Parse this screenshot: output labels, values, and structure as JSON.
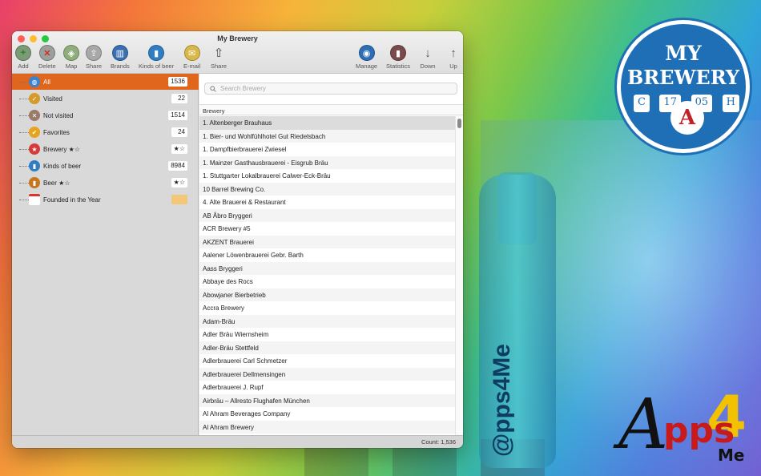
{
  "window": {
    "title": "My Brewery"
  },
  "toolbar": {
    "add": "Add",
    "delete": "Delete",
    "map": "Map",
    "share1": "Share",
    "brands": "Brands",
    "kinds": "Kinds of beer",
    "email": "E-mail",
    "share2": "Share",
    "manage": "Manage",
    "statistics": "Statistics",
    "down": "Down",
    "up": "Up"
  },
  "sidebar": {
    "items": [
      {
        "label": "All",
        "count": "1536"
      },
      {
        "label": "Visited",
        "count": "22"
      },
      {
        "label": "Not visited",
        "count": "1514"
      },
      {
        "label": "Favorites",
        "count": "24"
      },
      {
        "label": "Brewery ★☆",
        "count": "★☆"
      },
      {
        "label": "Kinds of beer",
        "count": "8984"
      },
      {
        "label": "Beer ★☆",
        "count": "★☆"
      },
      {
        "label": "Founded in the Year",
        "count": ""
      }
    ]
  },
  "search": {
    "placeholder": "Search Brewery"
  },
  "table": {
    "column": "Brewery",
    "rows": [
      "1. Altenberger Brauhaus",
      "1. Bier- und Wohlfühlhotel Gut Riedelsbach",
      "1. Dampfbierbrauerei Zwiesel",
      "1. Mainzer Gasthausbrauerei - Eisgrub Bräu",
      "1. Stuttgarter Lokalbrauerei Calwer-Eck-Bräu",
      "10 Barrel Brewing Co.",
      "4. Alte Brauerei & Restaurant",
      "AB Åbro Bryggeri",
      "ACR Brewery #5",
      "AKZENT Brauerei",
      "Aalener Löwenbrauerei Gebr. Barth",
      "Aass Bryggeri",
      "Abbaye des Rocs",
      "Abowjaner Bierbetrieb",
      "Accra Brewery",
      "Adam-Bräu",
      "Adler Bräu Wiernsheim",
      "Adler-Bräu Stettfeld",
      "Adlerbrauerei Carl Schmetzer",
      "Adlerbrauerei Dellmensingen",
      "Adlerbrauerei J. Rupf",
      "Airbräu – Allresto Flughafen München",
      "Al Ahram Beverages Company",
      "Al Ahram Brewery"
    ]
  },
  "status": {
    "count": "Count: 1,536"
  },
  "badge": {
    "line1": "MY",
    "line2": "BREWERY",
    "c": "C",
    "n17": "17",
    "n05": "05",
    "h": "H",
    "seal": "A"
  },
  "logo": {
    "a": "A",
    "pps": "pps",
    "four": "4",
    "me": "Me"
  },
  "bottle": {
    "text": "@pps4Me"
  },
  "colors": {
    "accent": "#e0661e",
    "badge": "#1f6fb6"
  }
}
